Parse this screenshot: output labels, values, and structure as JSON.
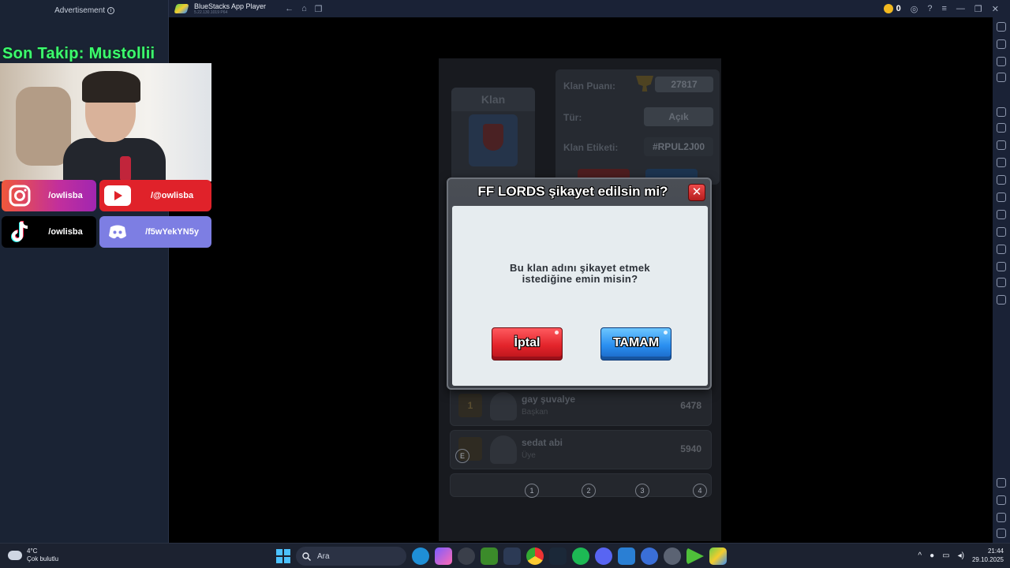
{
  "ad": {
    "label": "Advertisement",
    "info": "i"
  },
  "stream": {
    "follow_text": "Son Takip: Mustollii",
    "socials": [
      {
        "label": "/owlisba",
        "icon": "instagram-icon"
      },
      {
        "label": "/@owlisba",
        "icon": "youtube-icon"
      },
      {
        "label": "/owlisba",
        "icon": "tiktok-icon"
      },
      {
        "label": "/f5wYekYN5y",
        "icon": "discord-icon"
      }
    ]
  },
  "bluestacks": {
    "title": "BlueStacks App Player",
    "version": "5.22.130.1019 P64",
    "coins": "0",
    "nav": [
      "←",
      "⌂",
      "❐"
    ],
    "window_controls": [
      "—",
      "❐",
      "✕"
    ]
  },
  "game": {
    "clan_tab": "Klan",
    "clan_points_label": "Klan Puanı:",
    "clan_points_value": "27817",
    "type_label": "Tür:",
    "type_value": "Açık",
    "tag_label": "Klan Etiketi:",
    "tag_value": "#RPUL2J00",
    "members": [
      {
        "rank": "1",
        "name": "gay şuvalye",
        "role": "Başkan",
        "score": "6478"
      },
      {
        "rank": "",
        "name": "sedat abi",
        "role": "Üye",
        "score": "5940"
      }
    ],
    "markers": [
      "E",
      "1",
      "2",
      "3",
      "4"
    ]
  },
  "dialog": {
    "title": "FF LORDS şikayet edilsin mi?",
    "close": "✕",
    "message_line1": "Bu klan adını şikayet etmek",
    "message_line2": "istediğine emin misin?",
    "cancel_label": "İptal",
    "ok_label": "TAMAM"
  },
  "taskbar": {
    "temp": "4°C",
    "weather": "Çok bulutlu",
    "search_placeholder": "Ara",
    "time": "21:44",
    "date": "29.10.2025"
  }
}
